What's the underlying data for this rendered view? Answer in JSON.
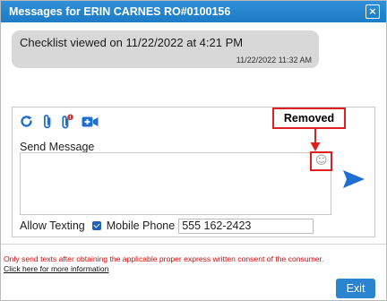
{
  "dialog": {
    "title": "Messages for ERIN CARNES RO#0100156",
    "close_glyph": "×"
  },
  "messages": [
    {
      "text": "Checklist viewed on 11/22/2022 at 4:21 PM",
      "timestamp": "11/22/2022 11:32 AM"
    }
  ],
  "toolbar": {
    "icons": [
      "refresh-icon",
      "attachment-icon",
      "attachment-notify-icon",
      "video-icon"
    ]
  },
  "composer": {
    "send_label": "Send Message",
    "message_value": "",
    "emoji_glyph": "☺",
    "allow_texting_label": "Allow Texting",
    "mobile_phone_label": "Mobile Phone",
    "mobile_phone_value": "555 162-2423"
  },
  "annotation": {
    "label": "Removed",
    "color": "#e02020"
  },
  "footer": {
    "disclaimer": "Only send texts after obtaining the applicable proper express written consent of the consumer.",
    "more_info_link": "Click here for more information",
    "exit_label": "Exit"
  },
  "colors": {
    "accent": "#1e7bc6",
    "bubble": "#d8d8d8",
    "warning": "#e00000"
  }
}
